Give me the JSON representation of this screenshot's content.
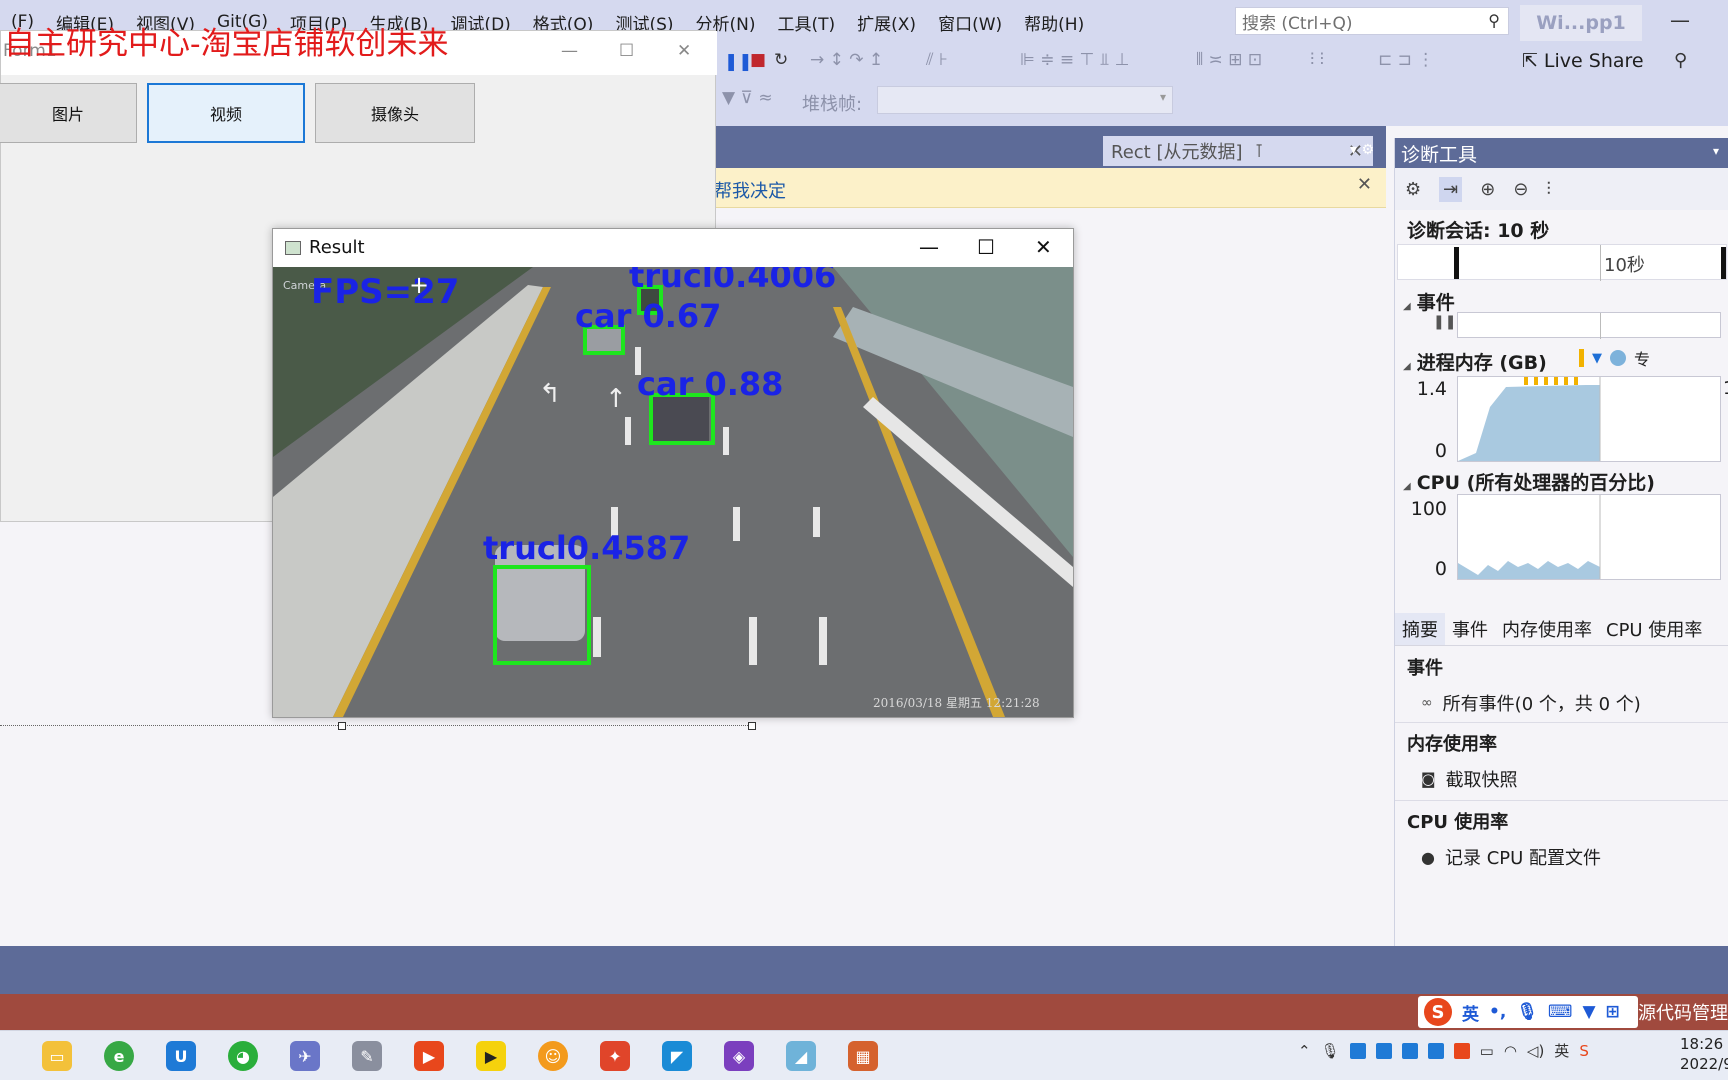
{
  "vs": {
    "menu": [
      "(F)",
      "编辑(E)",
      "视图(V)",
      "Git(G)",
      "项目(P)",
      "生成(B)",
      "调试(D)",
      "格式(O)",
      "测试(S)",
      "分析(N)",
      "工具(T)",
      "扩展(X)",
      "窗口(W)",
      "帮助(H)"
    ],
    "search_placeholder": "搜索 (Ctrl+Q)",
    "solution_name": "Wi...pp1",
    "live_share": "Live Share",
    "stack_frame_label": "堆栈帧:",
    "doc_tab": "Rect [从元数据]",
    "infobar_text": "帮我决定"
  },
  "form1": {
    "title": "Form1",
    "overlay_text": "自主研究中心-淘宝店铺软创未来",
    "buttons": [
      "图片",
      "视频",
      "摄像头"
    ]
  },
  "result": {
    "title": "Result",
    "fps_text": "FPS=27",
    "camera_label": "Camera",
    "timestamp": "2016/03/18 星期五 12:21:28",
    "detections": [
      {
        "label": "trucl0.4006"
      },
      {
        "label": "car 0.67"
      },
      {
        "label": "car 0.88"
      },
      {
        "label": "trucl0.4587"
      }
    ]
  },
  "diag": {
    "title": "诊断工具",
    "session": "诊断会话: 10 秒",
    "timeline_label": "10秒",
    "sections": {
      "events": "事件",
      "memory": "进程内存 (GB)",
      "cpu": "CPU (所有处理器的百分比)"
    },
    "memory_legend_extra": "专",
    "memory_ymax": "1.4",
    "memory_ymin": "0",
    "cpu_ymax": "100",
    "cpu_ymin": "0",
    "tabs": [
      "摘要",
      "事件",
      "内存使用率",
      "CPU 使用率"
    ],
    "groups": [
      {
        "header": "事件",
        "item": "所有事件(0 个，共 0 个)"
      },
      {
        "header": "内存使用率",
        "item": "截取快照"
      },
      {
        "header": "CPU 使用率",
        "item": "记录 CPU 配置文件"
      }
    ]
  },
  "status": {
    "ime_lang": "英",
    "source_control": "源代码管理"
  },
  "tray": {
    "lang": "英",
    "time": "18:26",
    "date": "2022/9"
  }
}
